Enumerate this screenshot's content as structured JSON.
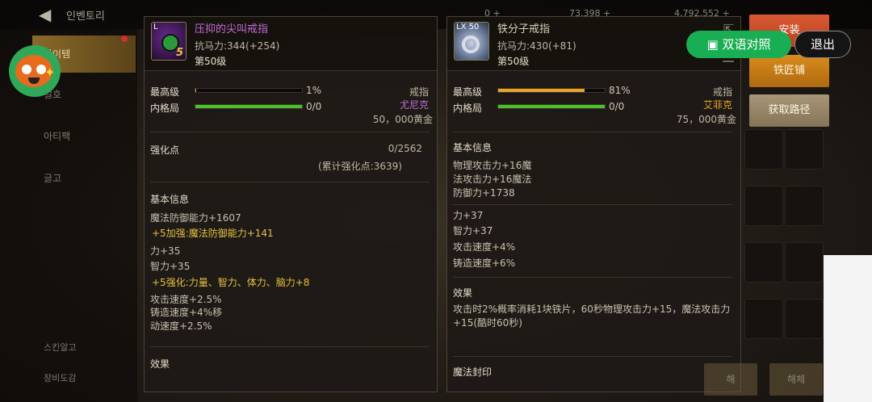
{
  "app": {
    "title": "인벤토리",
    "currency1": "73,398 +",
    "currency2": "4,792,552 +",
    "currency0": "0 +"
  },
  "nav": {
    "items": [
      {
        "label": "아이템"
      },
      {
        "label": "일호"
      },
      {
        "label": "아티팩"
      },
      {
        "label": "글고"
      }
    ],
    "bottom": [
      {
        "label": "스킨알고"
      },
      {
        "label": "장비도감"
      }
    ]
  },
  "left_item": {
    "name": "压抑的尖叫戒指",
    "stat": "抗马力:344(+254)",
    "level": "第50级",
    "icon_tag": "L",
    "icon_badge": "5",
    "max_grade_label": "最高级",
    "max_grade_value": "1%",
    "max_grade_fill": 0.01,
    "inner_label": "内格局",
    "inner_value": "0/0",
    "inner_fill": 1.0,
    "type": "戒指",
    "maker": "尤尼克",
    "price": "50，000黄金",
    "reinforce_label": "强化点",
    "reinforce_value": "0/2562",
    "reinforce_total": "(累计强化点:3639)",
    "basic_title": "基本信息",
    "lines": [
      {
        "text": "魔法防御能力+1607",
        "gold": false
      },
      {
        "text": "+5加强:魔法防御能力+141",
        "gold": true
      },
      {
        "text": "力+35",
        "gold": false
      },
      {
        "text": "智力+35",
        "gold": false
      },
      {
        "text": "+5强化:力量、智力、体力、脑力+8",
        "gold": true
      },
      {
        "text": "攻击速度+2.5%",
        "gold": false
      },
      {
        "text": "铸造速度+4%移",
        "gold": false
      },
      {
        "text": "动速度+2.5%",
        "gold": false
      }
    ],
    "effect_title": "效果"
  },
  "right_item": {
    "name": "铁分子戒指",
    "stat": "抗马力:430(+81)",
    "level": "第50级",
    "icon_tag": "LX 50",
    "max_grade_label": "最高级",
    "max_grade_value": "81%",
    "max_grade_fill": 0.81,
    "inner_label": "内格局",
    "inner_value": "0/0",
    "inner_fill": 1.0,
    "type": "戒指",
    "maker": "艾菲克",
    "price": "75，000黄金",
    "basic_title": "基本信息",
    "group1": [
      "物理攻击力+16魔",
      "法攻击力+16魔法",
      "防御力+1738"
    ],
    "group2": [
      "力+37",
      "智力+37",
      "攻击速度+4%",
      "铸造速度+6%"
    ],
    "effect_title": "效果",
    "effect_text": "攻击时2%概率消耗1块铁片，60秒物理攻击力+15，魔法攻击力+15(酷时60秒)",
    "seal_title": "魔法封印"
  },
  "actions": {
    "install": "安装",
    "smith": "铁匠铺",
    "route": "获取路径"
  },
  "overlay": {
    "bilingual": "双语对照",
    "exit": "退出"
  },
  "bottom_buttons": {
    "b1": "해",
    "b2": "해체"
  },
  "colors": {
    "orange_bar": "#e6a52a",
    "green_bar": "#4cc02a",
    "epic_purple": "#c46ad6",
    "gold_text": "#e6c040",
    "overlay_green": "#1aae54"
  }
}
